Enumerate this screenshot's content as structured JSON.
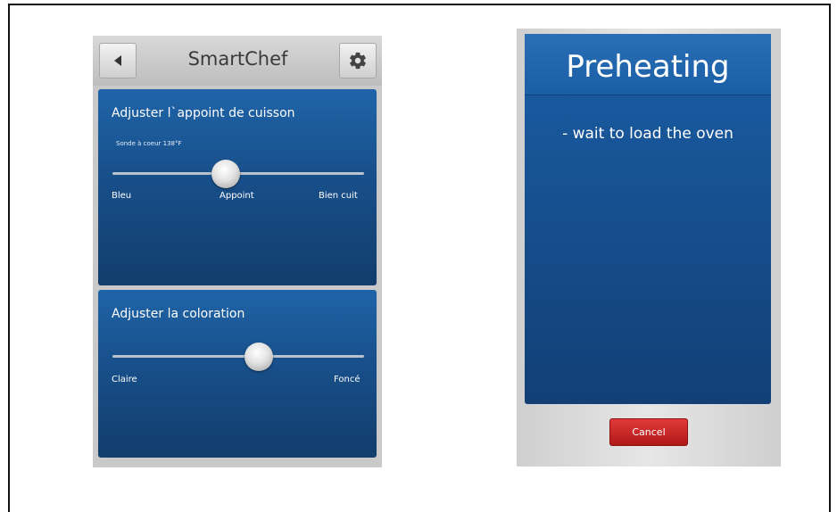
{
  "left_screen": {
    "app_title": "SmartChef",
    "cooking_panel": {
      "title": "Adjuster l`appoint de cuisson",
      "probe_label": "Sonde à coeur 138°F",
      "slider": {
        "labels": [
          "Bleu",
          "Appoint",
          "Bien cuit"
        ],
        "selected": "Appoint",
        "level_fraction": 0.45
      }
    },
    "color_panel": {
      "title": "Adjuster la coloration",
      "slider": {
        "labels": [
          "Claire",
          "Foncé"
        ],
        "level_fraction": 0.58
      }
    }
  },
  "right_screen": {
    "title": "Preheating",
    "message": "- wait to load the oven",
    "cancel_label": "Cancel"
  },
  "colors": {
    "panel_blue": "#1f64a8",
    "cancel_red": "#d12828"
  }
}
